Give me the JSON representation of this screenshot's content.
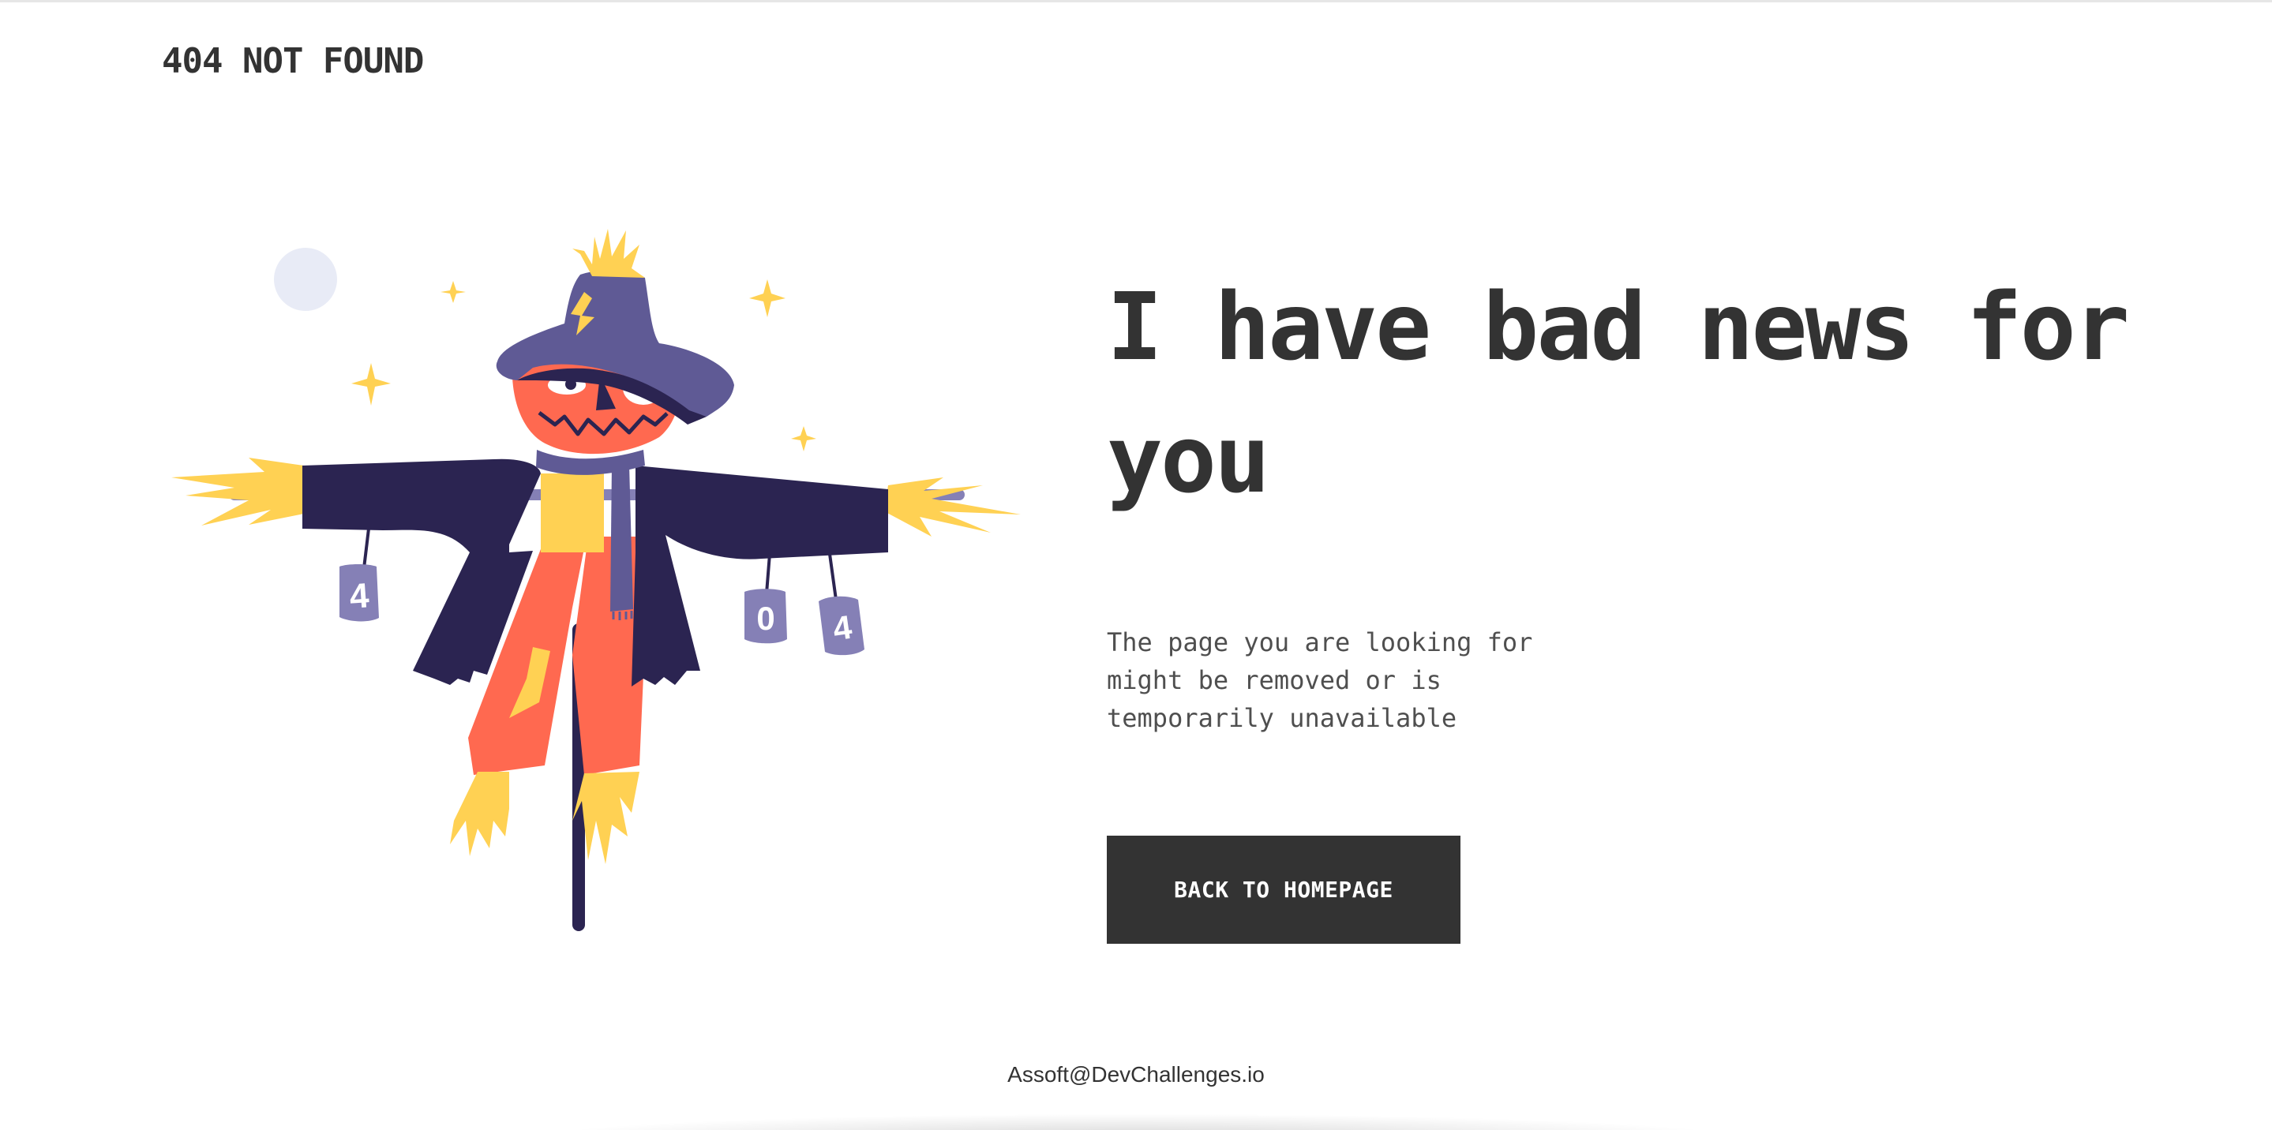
{
  "header": {
    "brand": "404 NOT FOUND"
  },
  "illustration": {
    "alt": "scarecrow",
    "can_digits": [
      "4",
      "0",
      "4"
    ]
  },
  "main": {
    "headline": "I have bad news for you",
    "message": "The page you are looking for might be removed or is temporarily unavailable",
    "button_label": "BACK TO HOMEPAGE"
  },
  "footer": {
    "credit": "Assoft@DevChallenges.io"
  },
  "colors": {
    "text_dark": "#333333",
    "button_bg": "#333333",
    "button_text": "#ffffff",
    "straw_yellow": "#FFD153",
    "hat_purple": "#5F5A95",
    "coat_navy": "#2B2451",
    "pumpkin_orange": "#FF6950",
    "can_lavender": "#8580B6"
  }
}
